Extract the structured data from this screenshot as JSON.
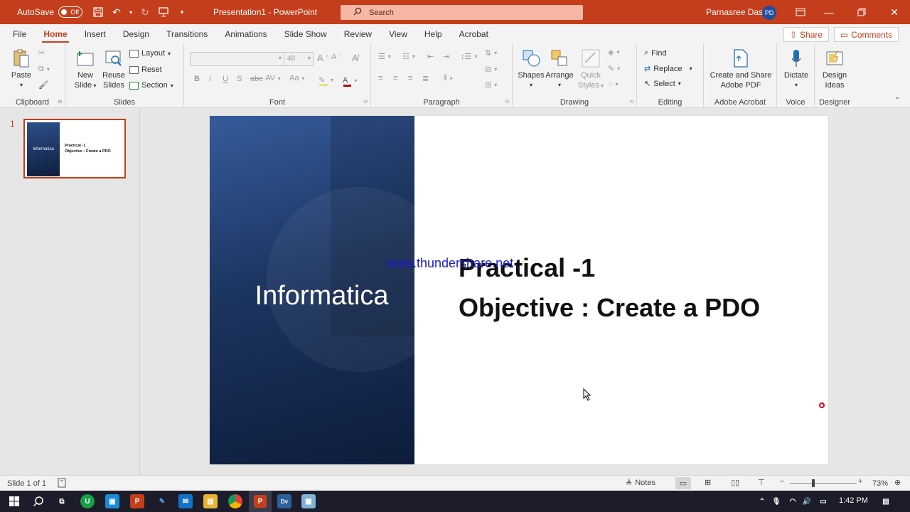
{
  "window": {
    "autosave_label": "AutoSave",
    "autosave_state": "Off",
    "doc_title": "Presentation1 - PowerPoint",
    "search_placeholder": "Search",
    "user_name": "Parnasree Das",
    "user_initials": "PD"
  },
  "tabs": [
    "File",
    "Home",
    "Insert",
    "Design",
    "Transitions",
    "Animations",
    "Slide Show",
    "Review",
    "View",
    "Help",
    "Acrobat"
  ],
  "active_tab": "Home",
  "share_label": "Share",
  "comments_label": "Comments",
  "ribbon": {
    "clipboard": {
      "paste": "Paste",
      "label": "Clipboard"
    },
    "slides": {
      "new_slide_1": "New",
      "new_slide_2": "Slide",
      "reuse_1": "Reuse",
      "reuse_2": "Slides",
      "layout": "Layout",
      "reset": "Reset",
      "section": "Section",
      "label": "Slides"
    },
    "font": {
      "size": "48",
      "label": "Font"
    },
    "paragraph": {
      "label": "Paragraph"
    },
    "drawing": {
      "shapes": "Shapes",
      "arrange": "Arrange",
      "quick_1": "Quick",
      "quick_2": "Styles",
      "label": "Drawing"
    },
    "editing": {
      "find": "Find",
      "replace": "Replace",
      "select": "Select",
      "label": "Editing"
    },
    "adobe": {
      "btn_1": "Create and Share",
      "btn_2": "Adobe PDF",
      "label": "Adobe Acrobat"
    },
    "voice": {
      "dictate": "Dictate",
      "label": "Voice"
    },
    "designer": {
      "btn_1": "Design",
      "btn_2": "Ideas",
      "label": "Designer"
    }
  },
  "thumbnail": {
    "number": "1",
    "left_text": "Informatica",
    "line1": "Practical -1",
    "line2": "Objective : Create a PDO"
  },
  "slide": {
    "left_title": "Informatica",
    "line1": "Practical -1",
    "line2": "Objective : Create a PDO",
    "watermark": "www.thundershare.net"
  },
  "status": {
    "slide_info": "Slide 1 of 1",
    "notes": "Notes",
    "zoom": "73%"
  },
  "taskbar": {
    "time": "1:42 PM"
  }
}
